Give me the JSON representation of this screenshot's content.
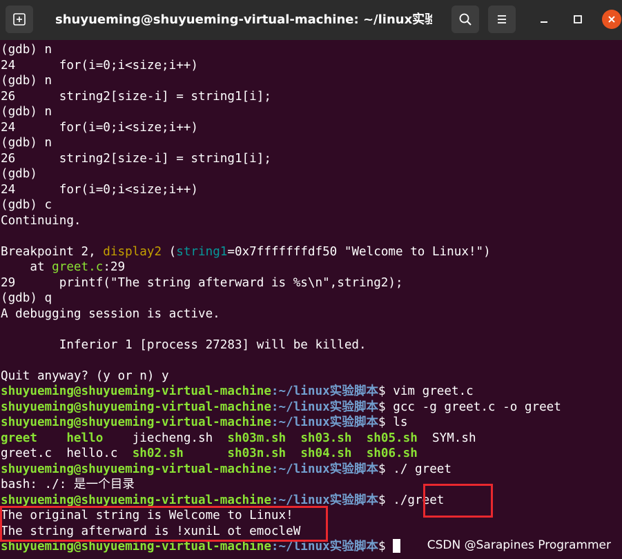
{
  "window": {
    "title": "shuyueming@shuyueming-virtual-machine: ~/linux实验脚本"
  },
  "icons": {
    "new_tab": "new-tab-icon",
    "search": "search-icon",
    "menu": "hamburger-menu-icon",
    "minimize": "minimize-icon",
    "maximize": "maximize-icon",
    "close": "close-icon"
  },
  "colors": {
    "background": "#300a24",
    "prompt_user": "#8ae234",
    "prompt_path": "#729fcf",
    "highlight_box": "#e8282e",
    "close_button": "#e95420"
  },
  "prompt": {
    "user": "shuyueming@shuyueming-virtual-machine",
    "path": ":~/linux实验脚本",
    "symbol": "$ "
  },
  "lines": {
    "l01": "(gdb) n",
    "l02": "24      for(i=0;i<size;i++)",
    "l03": "(gdb) n",
    "l04": "26      string2[size-i] = string1[i];",
    "l05": "(gdb) n",
    "l06": "24      for(i=0;i<size;i++)",
    "l07": "(gdb) n",
    "l08": "26      string2[size-i] = string1[i];",
    "l09": "(gdb)",
    "l10": "24      for(i=0;i<size;i++)",
    "l11": "(gdb) c",
    "l12": "Continuing.",
    "l14_a": "Breakpoint 2, ",
    "l14_b": "display2",
    "l14_c": " (",
    "l14_d": "string1",
    "l14_e": "=0x7fffffffdf50 \"Welcome to Linux!\")",
    "l15_a": "    at ",
    "l15_b": "greet.c",
    "l15_c": ":29",
    "l16": "29      printf(\"The string afterward is %s\\n\",string2);",
    "l17": "(gdb) q",
    "l18": "A debugging session is active.",
    "l20": "        Inferior 1 [process 27283] will be killed.",
    "l22": "Quit anyway? (y or n) y",
    "cmd1": "vim greet.c",
    "cmd2": "gcc -g greet.c -o greet",
    "cmd3": "ls",
    "ls_row1": [
      {
        "name": "greet",
        "exec": true,
        "pad": "    "
      },
      {
        "name": "hello",
        "exec": true,
        "pad": "    "
      },
      {
        "name": "jiecheng.sh",
        "exec": false,
        "pad": "  "
      },
      {
        "name": "sh03m.sh",
        "exec": true,
        "pad": "  "
      },
      {
        "name": "sh03.sh",
        "exec": true,
        "pad": "  "
      },
      {
        "name": "sh05.sh",
        "exec": true,
        "pad": "  "
      },
      {
        "name": "SYM.sh",
        "exec": false,
        "pad": ""
      }
    ],
    "ls_row2": [
      {
        "name": "greet.c",
        "exec": false,
        "pad": "  "
      },
      {
        "name": "hello.c",
        "exec": false,
        "pad": "  "
      },
      {
        "name": "sh02.sh",
        "exec": true,
        "pad": "      "
      },
      {
        "name": "sh03n.sh",
        "exec": true,
        "pad": "  "
      },
      {
        "name": "sh04.sh",
        "exec": true,
        "pad": "  "
      },
      {
        "name": "sh06.sh",
        "exec": true,
        "pad": ""
      }
    ],
    "cmd4": "./ greet",
    "bash_err": "bash: ./: 是一个目录",
    "cmd5": "./greet",
    "out1": "The original string is Welcome to Linux!",
    "out2": "The string afterward is !xuniL ot emocleW"
  },
  "watermark": "CSDN @Sarapines Programmer"
}
